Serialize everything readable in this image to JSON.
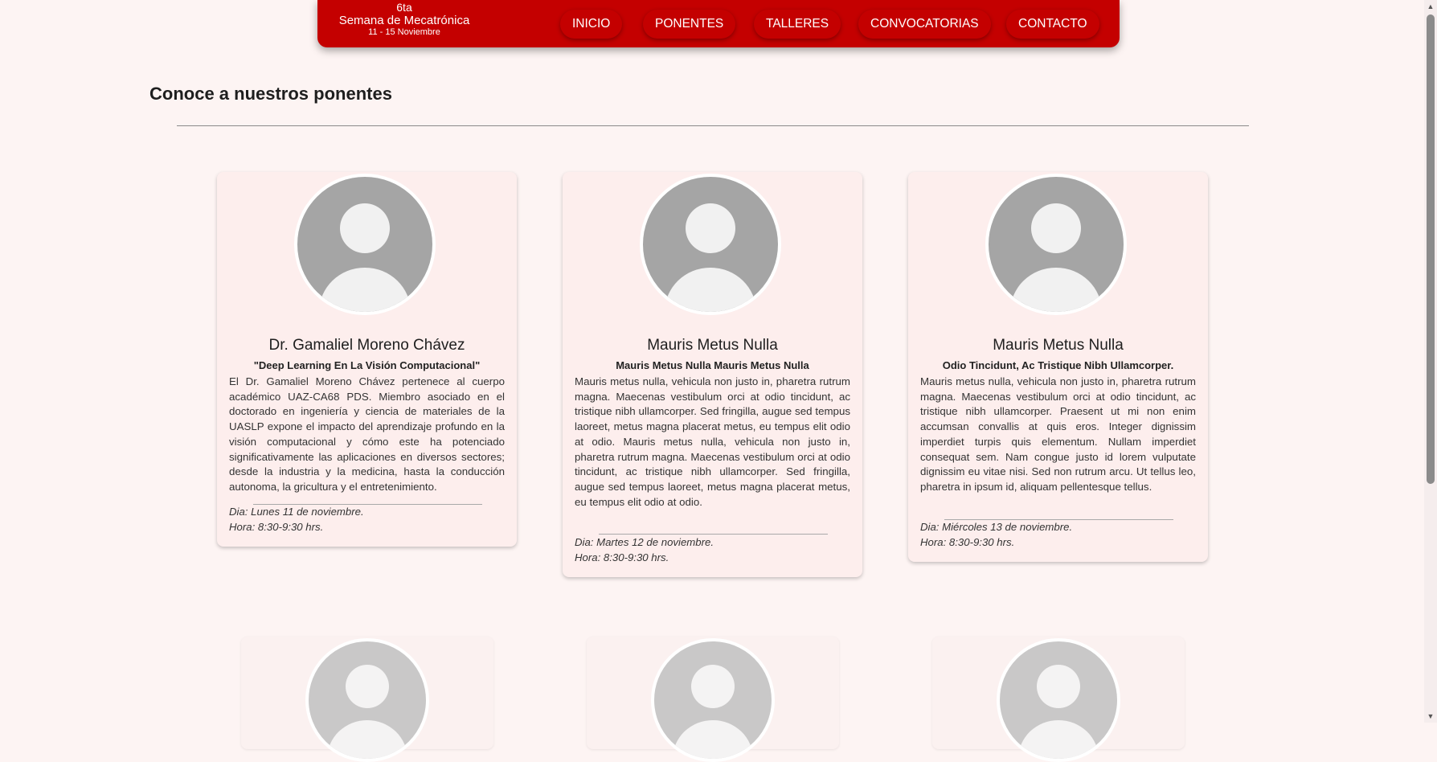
{
  "header": {
    "brand_line1": "6ta",
    "brand_line2": "Semana de Mecatrónica",
    "brand_line3": "11 - 15 Noviembre",
    "nav": [
      "INICIO",
      "PONENTES",
      "TALLERES",
      "CONVOCATORIAS",
      "CONTACTO"
    ],
    "color": "#c40000"
  },
  "page": {
    "title": "Conoce a nuestros ponentes"
  },
  "speakers": [
    {
      "name": "Dr. Gamaliel Moreno Chávez",
      "talk": "\"Deep Learning En La Visión Computacional\"",
      "bio": "El Dr. Gamaliel Moreno Chávez pertenece al cuerpo académico UAZ-CA68 PDS. Miembro asociado en el doctorado en ingeniería y ciencia de materiales de la UASLP expone el impacto del aprendizaje profundo en la visión computacional y cómo este ha potenciado significativamente las aplicaciones en diversos sectores; desde la industria y la medicina, hasta la conducción autonoma, la gricultura y el entretenimiento.",
      "day": "Dia: Lunes 11 de noviembre.",
      "time": "Hora: 8:30-9:30 hrs."
    },
    {
      "name": "Mauris Metus Nulla",
      "talk": "Mauris Metus Nulla Mauris Metus Nulla",
      "bio": "Mauris metus nulla, vehicula non justo in, pharetra rutrum magna. Maecenas vestibulum orci at odio tincidunt, ac tristique nibh ullamcorper. Sed fringilla, augue sed tempus laoreet, metus magna placerat metus, eu tempus elit odio at odio. Mauris metus nulla, vehicula non justo in, pharetra rutrum magna. Maecenas vestibulum orci at odio tincidunt, ac tristique nibh ullamcorper. Sed fringilla, augue sed tempus laoreet, metus magna placerat metus, eu tempus elit odio at odio.",
      "day": "Dia: Martes 12 de noviembre.",
      "time": "Hora: 8:30-9:30 hrs."
    },
    {
      "name": "Mauris Metus Nulla",
      "talk": "Odio Tincidunt, Ac Tristique Nibh Ullamcorper.",
      "bio": "Mauris metus nulla, vehicula non justo in, pharetra rutrum magna. Maecenas vestibulum orci at odio tincidunt, ac tristique nibh ullamcorper. Praesent ut mi non enim accumsan convallis at quis eros. Integer dignissim imperdiet turpis quis elementum. Nullam imperdiet consequat sem. Nam congue justo id lorem vulputate dignissim eu vitae nisi. Sed non rutrum arcu. Ut tellus leo, pharetra in ipsum id, aliquam pellentesque tellus.",
      "day": "Dia: Miércoles 13 de noviembre.",
      "time": "Hora: 8:30-9:30 hrs."
    }
  ],
  "icons": {
    "avatar": "user-placeholder-icon"
  }
}
